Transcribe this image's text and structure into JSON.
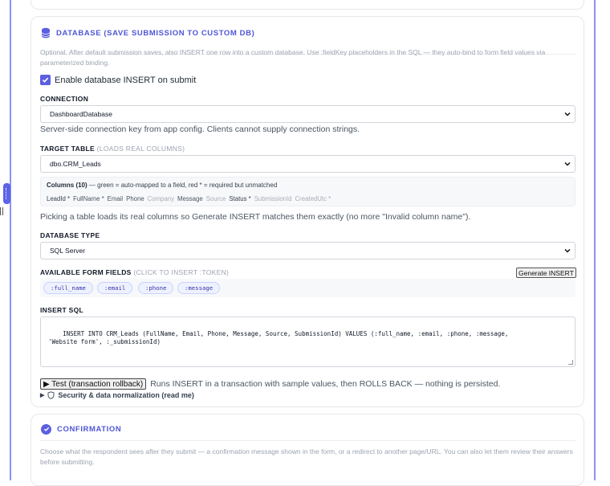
{
  "database": {
    "title": "DATABASE (SAVE SUBMISSION TO CUSTOM DB)",
    "description": "Optional. After default submission saves, also INSERT one row into a custom database. Use :fieldKey placeholders in the SQL — they auto-bind to form field values via parameterized binding.",
    "enable_label": "Enable database INSERT on submit",
    "enable_checked": true,
    "connection_label": "CONNECTION",
    "connection_value": "DashboardDatabase",
    "connection_help": "Server-side connection key from app config. Clients cannot supply connection strings.",
    "target_table_label": "TARGET TABLE",
    "target_table_sub": "(LOADS REAL COLUMNS)",
    "target_table_value": "dbo.CRM_Leads",
    "columns_title": "Columns (10)",
    "columns_legend": " — green = auto-mapped to a field, red * = required but unmatched",
    "columns": [
      {
        "text": "LeadId *",
        "kind": "red"
      },
      {
        "text": "FullName *",
        "kind": "green"
      },
      {
        "text": "Email",
        "kind": "green"
      },
      {
        "text": "Phone",
        "kind": "green"
      },
      {
        "text": "Company",
        "kind": "grey"
      },
      {
        "text": "Message",
        "kind": "green"
      },
      {
        "text": "Source",
        "kind": "grey"
      },
      {
        "text": "Status *",
        "kind": "red"
      },
      {
        "text": "SubmissionId",
        "kind": "grey"
      },
      {
        "text": "CreatedUtc *",
        "kind": "grey"
      }
    ],
    "table_help": "Picking a table loads its real columns so Generate INSERT matches them exactly (no more \"Invalid column name\").",
    "db_type_label": "DATABASE TYPE",
    "db_type_value": "SQL Server",
    "fields_label": "AVAILABLE FORM FIELDS",
    "fields_sub": "(CLICK TO INSERT :TOKEN)",
    "generate_label": "Generate INSERT",
    "tokens": [
      ":full_name",
      ":email",
      ":phone",
      ":message"
    ],
    "sql_label": "INSERT SQL",
    "sql_value": "INSERT INTO CRM_Leads (FullName, Email, Phone, Message, Source, SubmissionId) VALUES (:full_name, :email, :phone, :message,\n'Website form', :_submissionId)",
    "test_label": "▶ Test (transaction rollback)",
    "test_desc": "Runs INSERT in a transaction with sample values, then ROLLS BACK — nothing is persisted.",
    "security_label": "Security & data normalization (read me)"
  },
  "confirmation": {
    "title": "CONFIRMATION",
    "description": "Choose what the respondent sees after they submit — a confirmation message shown in the form, or a redirect to another page/URL. You can also let them review their answers before submitting."
  },
  "colors": {
    "accent": "#5b5fe0",
    "title": "#4f56d6"
  }
}
